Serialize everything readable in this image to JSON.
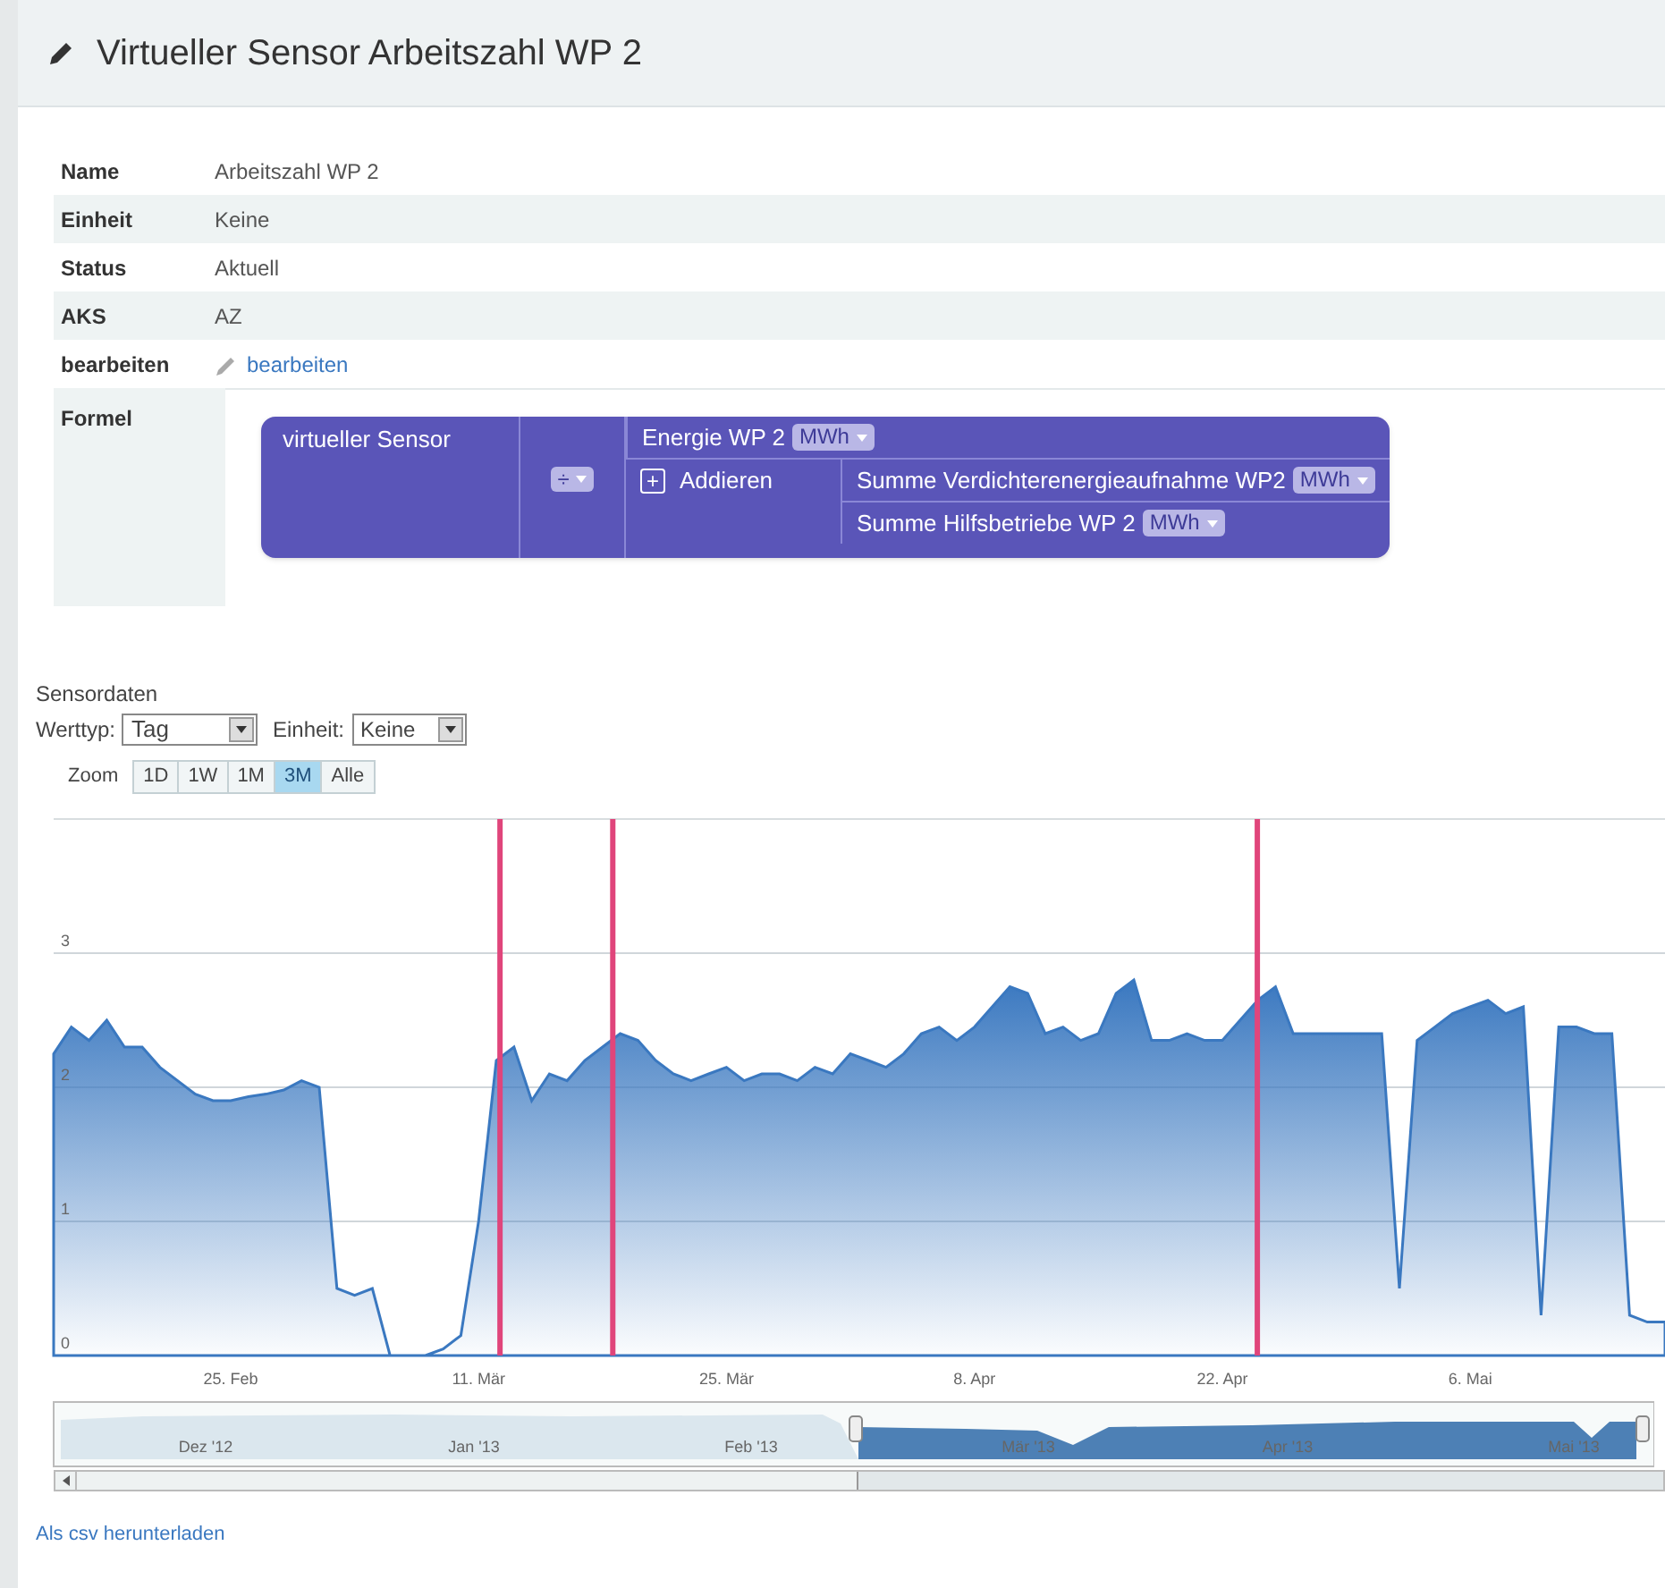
{
  "title": "Virtueller Sensor Arbeitszahl WP 2",
  "properties": [
    {
      "label": "Name",
      "value": "Arbeitszahl WP 2",
      "kind": "text"
    },
    {
      "label": "Einheit",
      "value": "Keine",
      "kind": "text"
    },
    {
      "label": "Status",
      "value": "Aktuell",
      "kind": "text"
    },
    {
      "label": "AKS",
      "value": "AZ",
      "kind": "text"
    },
    {
      "label": "bearbeiten",
      "value": "bearbeiten",
      "kind": "link"
    }
  ],
  "formula": {
    "label": "Formel",
    "sensor_label": "virtueller Sensor",
    "operator": "÷",
    "operands": [
      {
        "kind": "sensor",
        "name": "Energie WP 2",
        "unit": "MWh"
      },
      {
        "kind": "group",
        "expand_symbol": "+",
        "name": "Addieren",
        "children": [
          {
            "kind": "sensor",
            "name": "Summe Verdichterenergieaufnahme WP2",
            "unit": "MWh"
          },
          {
            "kind": "sensor",
            "name": "Summe Hilfsbetriebe WP 2",
            "unit": "MWh"
          }
        ]
      }
    ]
  },
  "sensordaten": {
    "title": "Sensordaten",
    "werttyp": {
      "label": "Werttyp:",
      "value": "Tag"
    },
    "einheit": {
      "label": "Einheit:",
      "value": "Keine"
    },
    "zoom": {
      "label": "Zoom",
      "buttons": [
        {
          "label": "1D",
          "selected": false
        },
        {
          "label": "1W",
          "selected": false
        },
        {
          "label": "1M",
          "selected": false
        },
        {
          "label": "3M",
          "selected": true
        },
        {
          "label": "Alle",
          "selected": false
        }
      ]
    }
  },
  "chart_data": {
    "type": "area",
    "categories": [
      null,
      null,
      null,
      null,
      null,
      null,
      null,
      null,
      null,
      null,
      "25. Feb",
      null,
      null,
      null,
      null,
      null,
      null,
      null,
      null,
      null,
      null,
      null,
      null,
      null,
      "11. Mär",
      null,
      null,
      null,
      null,
      null,
      null,
      null,
      null,
      null,
      null,
      null,
      null,
      null,
      "25. Mär",
      null,
      null,
      null,
      null,
      null,
      null,
      null,
      null,
      null,
      null,
      null,
      null,
      null,
      "8. Apr",
      null,
      null,
      null,
      null,
      null,
      null,
      null,
      null,
      null,
      null,
      null,
      null,
      null,
      "22. Apr",
      null,
      null,
      null,
      null,
      null,
      null,
      null,
      null,
      null,
      null,
      null,
      null,
      null,
      "6. Mai",
      null,
      null,
      null,
      null,
      null,
      null,
      null,
      null,
      null,
      null,
      null
    ],
    "series": [
      {
        "color": "#3a78c0",
        "values": [
          2.25,
          2.45,
          2.35,
          2.5,
          2.3,
          2.3,
          2.15,
          2.05,
          1.95,
          1.9,
          1.9,
          1.93,
          1.95,
          1.98,
          2.05,
          2.0,
          0.5,
          0.45,
          0.5,
          0.0,
          0.0,
          0.0,
          0.05,
          0.15,
          1.0,
          2.2,
          2.3,
          1.9,
          2.1,
          2.05,
          2.2,
          2.3,
          2.4,
          2.35,
          2.2,
          2.1,
          2.05,
          2.1,
          2.15,
          2.05,
          2.1,
          2.1,
          2.05,
          2.15,
          2.1,
          2.25,
          2.2,
          2.15,
          2.25,
          2.4,
          2.45,
          2.35,
          2.45,
          2.6,
          2.75,
          2.7,
          2.4,
          2.45,
          2.35,
          2.4,
          2.7,
          2.8,
          2.35,
          2.35,
          2.4,
          2.35,
          2.35,
          2.5,
          2.65,
          2.75,
          2.4,
          2.4,
          2.4,
          2.4,
          2.4,
          2.4,
          0.5,
          2.35,
          2.45,
          2.55,
          2.6,
          2.65,
          2.55,
          2.6,
          0.3,
          2.45,
          2.45,
          2.4,
          2.4,
          0.3,
          0.25,
          0.25
        ]
      }
    ],
    "ylim": [
      0,
      4
    ],
    "yticks": [
      0,
      1,
      2,
      3
    ],
    "grid": true
  },
  "navigator": {
    "labels": [
      "Dez '12",
      "Jan '13",
      "Feb '13",
      "Mär '13",
      "Apr '13",
      "Mai '13"
    ]
  },
  "download_link": "Als csv herunterladen"
}
